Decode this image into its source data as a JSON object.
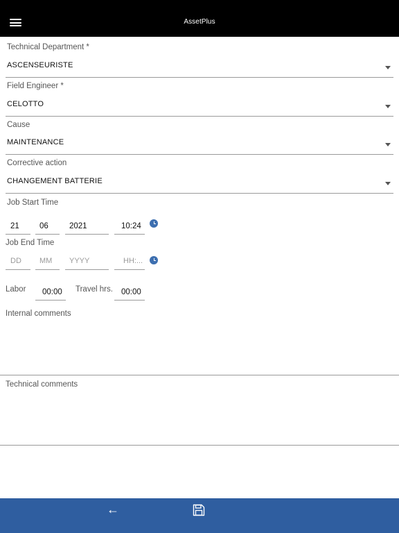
{
  "header": {
    "title": "AssetPlus"
  },
  "fields": {
    "technical_department": {
      "label": "Technical Department *",
      "value": "ASCENSEURISTE"
    },
    "field_engineer": {
      "label": "Field Engineer *",
      "value": "CELOTTO"
    },
    "cause": {
      "label": "Cause",
      "value": "MAINTENANCE"
    },
    "corrective_action": {
      "label": "Corrective action",
      "value": "CHANGEMENT BATTERIE"
    }
  },
  "job_start": {
    "label": "Job Start Time",
    "day": "21",
    "month": "06",
    "year": "2021",
    "time": "10:24"
  },
  "job_end": {
    "label": "Job End Time",
    "day_placeholder": "DD",
    "month_placeholder": "MM",
    "year_placeholder": "YYYY",
    "time_placeholder": "HH:..."
  },
  "labor": {
    "label": "Labor",
    "value": "00:00"
  },
  "travel": {
    "label": "Travel hrs.",
    "value": "00:00"
  },
  "internal_comments": {
    "label": "Internal comments"
  },
  "technical_comments": {
    "label": "Technical comments"
  },
  "icons": {
    "menu": "hamburger-icon",
    "clock": "clock-icon",
    "back": "arrow-left-icon",
    "save": "floppy-disk-icon"
  },
  "colors": {
    "header": "#000000",
    "footer": "#2f5ea0",
    "accent": "#3d6fb0"
  }
}
